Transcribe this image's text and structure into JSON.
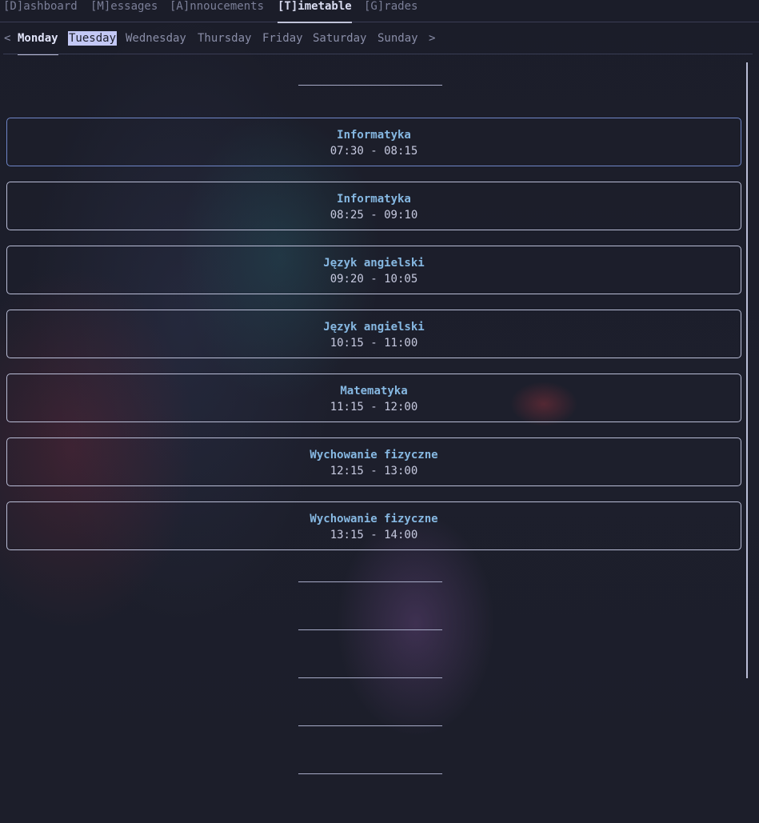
{
  "nav": {
    "tabs": [
      {
        "label": "[D]ashboard"
      },
      {
        "label": "[M]essages"
      },
      {
        "label": "[A]nnoucements"
      },
      {
        "label": "[T]imetable"
      },
      {
        "label": "[G]rades"
      }
    ],
    "active_tab": "[T]imetable"
  },
  "days": {
    "prev": "<",
    "next": ">",
    "items": [
      {
        "label": "Monday"
      },
      {
        "label": "Tuesday"
      },
      {
        "label": "Wednesday"
      },
      {
        "label": "Thursday"
      },
      {
        "label": "Friday"
      },
      {
        "label": "Saturday"
      },
      {
        "label": "Sunday"
      }
    ],
    "current_day": "Monday",
    "selected_day": "Tuesday"
  },
  "lessons": [
    {
      "subject": "Informatyka",
      "time": "07:30 - 08:15"
    },
    {
      "subject": "Informatyka",
      "time": "08:25 - 09:10"
    },
    {
      "subject": "Język angielski",
      "time": "09:20 - 10:05"
    },
    {
      "subject": "Język angielski",
      "time": "10:15 - 11:00"
    },
    {
      "subject": "Matematyka",
      "time": "11:15 - 12:00"
    },
    {
      "subject": "Wychowanie fizyczne",
      "time": "12:15 - 13:00"
    },
    {
      "subject": "Wychowanie fizyczne",
      "time": "13:15 - 14:00"
    }
  ],
  "colors": {
    "subject": "#86b8e2",
    "border": "#b9bdd6",
    "focused_border": "#6f86c8",
    "selected_bg": "#c3c8f5"
  }
}
